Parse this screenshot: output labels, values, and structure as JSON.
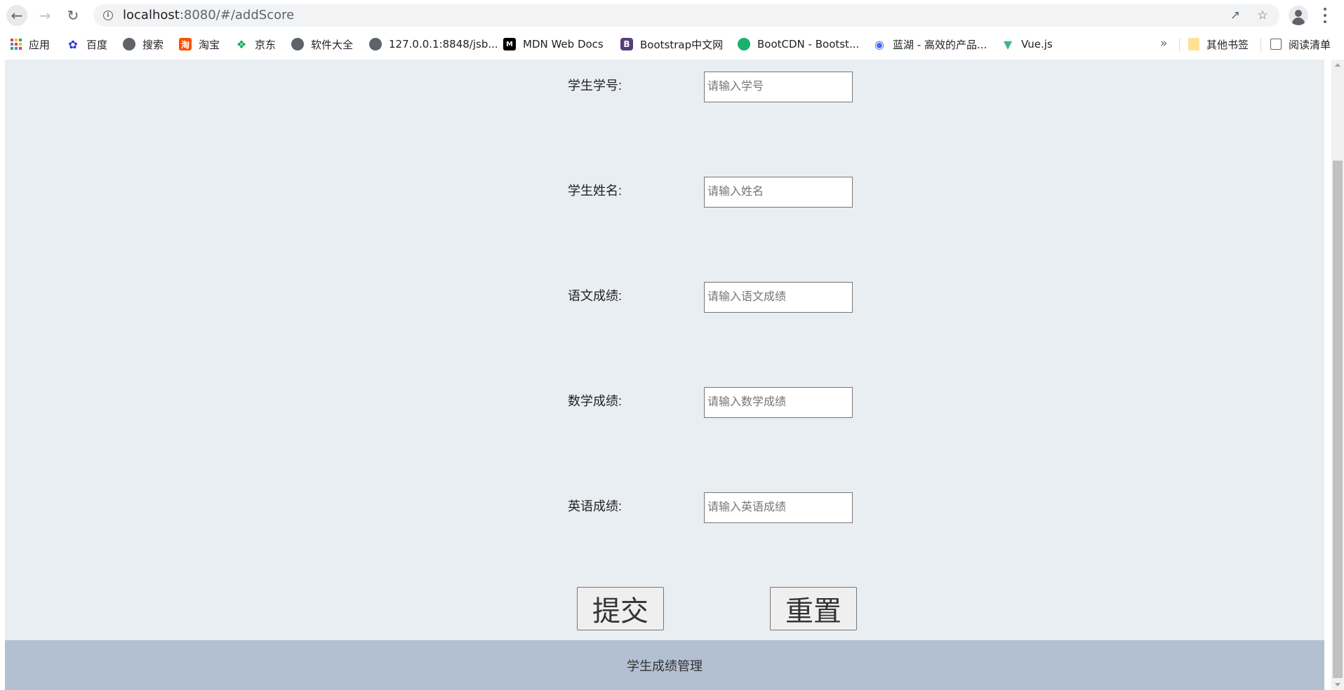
{
  "browser": {
    "url_host": "localhost",
    "url_rest": ":8080/#/addScore"
  },
  "bookmarks": [
    {
      "label": "应用",
      "icon": "apps-grid-icon"
    },
    {
      "label": "百度",
      "icon": "baidu-paw-icon"
    },
    {
      "label": "搜索",
      "icon": "globe-icon"
    },
    {
      "label": "淘宝",
      "icon": "taobao-icon"
    },
    {
      "label": "京东",
      "icon": "jd-icon"
    },
    {
      "label": "软件大全",
      "icon": "globe-icon"
    },
    {
      "label": "127.0.0.1:8848/jsb...",
      "icon": "globe-icon"
    },
    {
      "label": "MDN Web Docs",
      "icon": "mdn-icon"
    },
    {
      "label": "Bootstrap中文网",
      "icon": "bootstrap-icon"
    },
    {
      "label": "BootCDN - Bootst...",
      "icon": "bootcdn-icon"
    },
    {
      "label": "蓝湖 - 高效的产品...",
      "icon": "lanhu-icon"
    },
    {
      "label": "Vue.js",
      "icon": "vue-icon"
    }
  ],
  "bookmarks_right": {
    "other": "其他书签",
    "reading_list": "阅读清单"
  },
  "form": {
    "fields": [
      {
        "label": "学生学号:",
        "placeholder": "请输入学号",
        "value": ""
      },
      {
        "label": "学生姓名:",
        "placeholder": "请输入姓名",
        "value": ""
      },
      {
        "label": "语文成绩:",
        "placeholder": "请输入语文成绩",
        "value": ""
      },
      {
        "label": "数学成绩:",
        "placeholder": "请输入数学成绩",
        "value": ""
      },
      {
        "label": "英语成绩:",
        "placeholder": "请输入英语成绩",
        "value": ""
      }
    ],
    "submit_label": "提交",
    "reset_label": "重置"
  },
  "footer": {
    "text": "学生成绩管理"
  }
}
